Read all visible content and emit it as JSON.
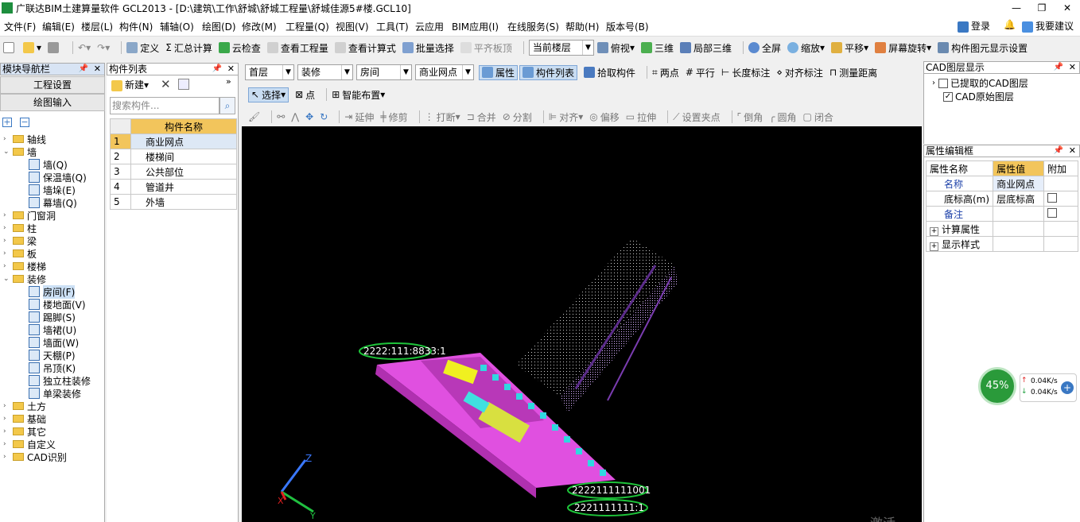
{
  "window": {
    "title": "广联达BIM土建算量软件 GCL2013 - [D:\\建筑\\工作\\舒城\\舒城工程量\\舒城佳源5#楼.GCL10]",
    "min": "—",
    "max": "❐",
    "close": "✕"
  },
  "menu": {
    "items": [
      "文件(F)",
      "编辑(E)",
      "楼层(L)",
      "构件(N)",
      "辅轴(O)",
      "绘图(D)",
      "修改(M)",
      "工程量(Q)",
      "视图(V)",
      "工具(T)",
      "云应用",
      "BIM应用(I)",
      "在线服务(S)",
      "帮助(H)",
      "版本号(B)"
    ],
    "login": "登录",
    "suggest": "我要建议"
  },
  "toolbar1": {
    "define": "定义",
    "sum": "汇总计算",
    "cloud_check": "云检查",
    "view_qty": "查看工程量",
    "view_formula": "查看计算式",
    "batch_select": "批量选择",
    "flush": "平齐板顶",
    "floor_label": "当前楼层",
    "top_view": "俯视",
    "three_d": "三维",
    "local_3d": "局部三维",
    "fullscreen": "全屏",
    "zoom": "缩放",
    "pan": "平移",
    "rotate": "屏幕旋转",
    "display_settings": "构件图元显示设置"
  },
  "toolbar2": {
    "floor": "首层",
    "category": "装修",
    "type": "房间",
    "component": "商业网点",
    "property": "属性",
    "comp_list": "构件列表",
    "pick": "拾取构件",
    "two_points": "两点",
    "parallel": "平行",
    "length_dim": "长度标注",
    "align_dim": "对齐标注",
    "measure": "测量距离"
  },
  "toolbar3": {
    "select": "选择",
    "point": "点",
    "smart": "智能布置"
  },
  "toolbar4": [
    "延伸",
    "修剪",
    "打断",
    "合并",
    "分割",
    "对齐",
    "偏移",
    "拉伸",
    "设置夹点",
    "倒角",
    "圆角",
    "闭合"
  ],
  "leftpanel": {
    "title": "模块导航栏",
    "btn_settings": "工程设置",
    "btn_draw": "绘图输入",
    "tree": [
      {
        "label": "轴线",
        "kind": "folder",
        "exp": "›"
      },
      {
        "label": "墙",
        "kind": "folder",
        "exp": "⌄"
      },
      {
        "label": "墙(Q)",
        "kind": "leaf"
      },
      {
        "label": "保温墙(Q)",
        "kind": "leaf"
      },
      {
        "label": "墙垛(E)",
        "kind": "leaf"
      },
      {
        "label": "幕墙(Q)",
        "kind": "leaf"
      },
      {
        "label": "门窗洞",
        "kind": "folder",
        "exp": "›"
      },
      {
        "label": "柱",
        "kind": "folder",
        "exp": "›"
      },
      {
        "label": "梁",
        "kind": "folder",
        "exp": "›"
      },
      {
        "label": "板",
        "kind": "folder",
        "exp": "›"
      },
      {
        "label": "楼梯",
        "kind": "folder",
        "exp": "›"
      },
      {
        "label": "装修",
        "kind": "folder",
        "exp": "⌄"
      },
      {
        "label": "房间(F)",
        "kind": "leaf",
        "selected": true
      },
      {
        "label": "楼地面(V)",
        "kind": "leaf"
      },
      {
        "label": "踢脚(S)",
        "kind": "leaf"
      },
      {
        "label": "墙裙(U)",
        "kind": "leaf"
      },
      {
        "label": "墙面(W)",
        "kind": "leaf"
      },
      {
        "label": "天棚(P)",
        "kind": "leaf"
      },
      {
        "label": "吊顶(K)",
        "kind": "leaf"
      },
      {
        "label": "独立柱装修",
        "kind": "leaf"
      },
      {
        "label": "单梁装修",
        "kind": "leaf"
      },
      {
        "label": "土方",
        "kind": "folder",
        "exp": "›"
      },
      {
        "label": "基础",
        "kind": "folder",
        "exp": "›"
      },
      {
        "label": "其它",
        "kind": "folder",
        "exp": "›"
      },
      {
        "label": "自定义",
        "kind": "folder",
        "exp": "›"
      },
      {
        "label": "CAD识别",
        "kind": "folder",
        "exp": "›"
      }
    ]
  },
  "complist": {
    "title": "构件列表",
    "new": "新建",
    "search_placeholder": "搜索构件...",
    "header": "构件名称",
    "rows": [
      {
        "n": "1",
        "name": "商业网点"
      },
      {
        "n": "2",
        "name": "楼梯间"
      },
      {
        "n": "3",
        "name": "公共部位"
      },
      {
        "n": "4",
        "name": "管道井"
      },
      {
        "n": "5",
        "name": "外墙"
      }
    ]
  },
  "cadlayers": {
    "title": "CAD图层显示",
    "items": [
      {
        "label": "已提取的CAD图层",
        "checked": false
      },
      {
        "label": "CAD原始图层",
        "checked": true
      }
    ]
  },
  "propeditor": {
    "title": "属性编辑框",
    "headers": [
      "属性名称",
      "属性值",
      "附加"
    ],
    "rows": [
      {
        "name": "名称",
        "value": "商业网点",
        "link": true
      },
      {
        "name": "底标高(m)",
        "value": "层底标高",
        "box": true
      },
      {
        "name": "备注",
        "value": "",
        "link": true,
        "box": true
      },
      {
        "name": "计算属性",
        "value": "",
        "plus": true
      },
      {
        "name": "显示样式",
        "value": "",
        "plus": true
      }
    ]
  },
  "canvas": {
    "labels": [
      "2222:111:8833:1",
      "2222111111001",
      "2221111111:1"
    ],
    "axes": [
      "Z",
      "X",
      "Y"
    ]
  },
  "speed": {
    "percent": "45%",
    "up": "0.04K/s",
    "down": "0.04K/s"
  },
  "watermark": "激活 Windows"
}
